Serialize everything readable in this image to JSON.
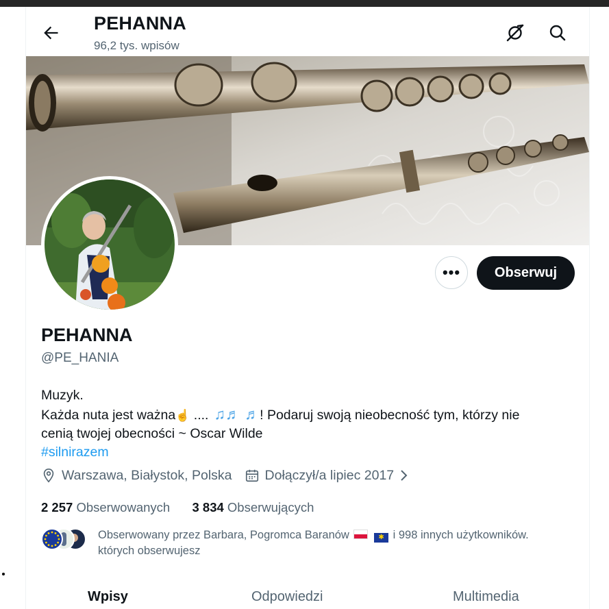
{
  "header": {
    "title": "PEHANNA",
    "subtitle": "96,2 tys. wpisów"
  },
  "profile": {
    "name": "PEHANNA",
    "handle": "@PE_HANIA",
    "bio": {
      "line1": "Muzyk.",
      "line2_a": "Każda nuta jest ważna",
      "line2_b": " ....",
      "line2_c": "!  Podaruj swoją nieobecność tym, którzy nie",
      "line3": "cenią twojej obecności ~ Oscar Wilde",
      "hashtag": "#silnirazem"
    },
    "location": "Warszawa, Białystok, Polska",
    "joined": "Dołączył/a lipiec 2017",
    "following_count": "2 257",
    "following_label": "Obserwowanych",
    "followers_count": "3 834",
    "followers_label": "Obserwujących",
    "followed_by_a": "Obserwowany przez Barbara, Pogromca Baranów",
    "followed_by_b": "i 998 innych użytkowników.",
    "followed_by_c": "których obserwujesz"
  },
  "actions": {
    "more_label": "•••",
    "follow_label": "Obserwuj"
  },
  "tabs": [
    {
      "label": "Wpisy",
      "active": true
    },
    {
      "label": "Odpowiedzi",
      "active": false
    },
    {
      "label": "Multimedia",
      "active": false
    }
  ],
  "colors": {
    "accent": "#1d9bf0",
    "text": "#0f1419",
    "muted": "#536471",
    "follow_button": "#0f1419"
  },
  "icons": [
    "back-arrow-icon",
    "grok-icon",
    "search-icon",
    "location-pin-icon",
    "calendar-icon",
    "chevron-right-icon",
    "raised-finger-emoji",
    "music-notes-emoji",
    "poland-flag",
    "eu-flag"
  ]
}
